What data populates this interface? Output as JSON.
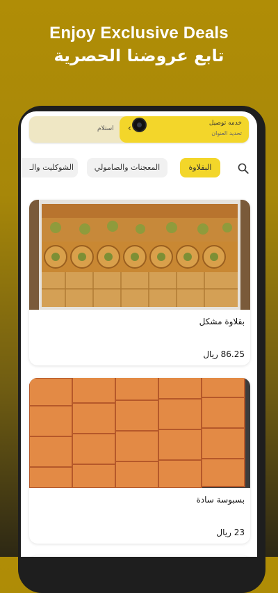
{
  "promo": {
    "headline_en": "Enjoy Exclusive Deals",
    "headline_ar": "تابع عروضنا الحصرية"
  },
  "delivery_bar": {
    "service_label": "خدمه توصيل",
    "address_label": "تحديد العنوان",
    "pickup_label": "استلام",
    "chevron_icon": "chevron-left-icon"
  },
  "categories": {
    "items": [
      {
        "label": "البقلاوة",
        "selected": true
      },
      {
        "label": "المعجنات والصامولي",
        "selected": false
      },
      {
        "label": "الشوكليت والـ",
        "selected": false
      }
    ],
    "search_icon": "search-icon"
  },
  "products": [
    {
      "name": "بقلاوة مشكل",
      "price": "86.25 ريال"
    },
    {
      "name": "بسبوسة سادة",
      "price": "23 ريال"
    }
  ],
  "colors": {
    "accent_yellow": "#f3d62a",
    "background_gold": "#b08d06",
    "chip_grey": "#f1f1f1"
  }
}
